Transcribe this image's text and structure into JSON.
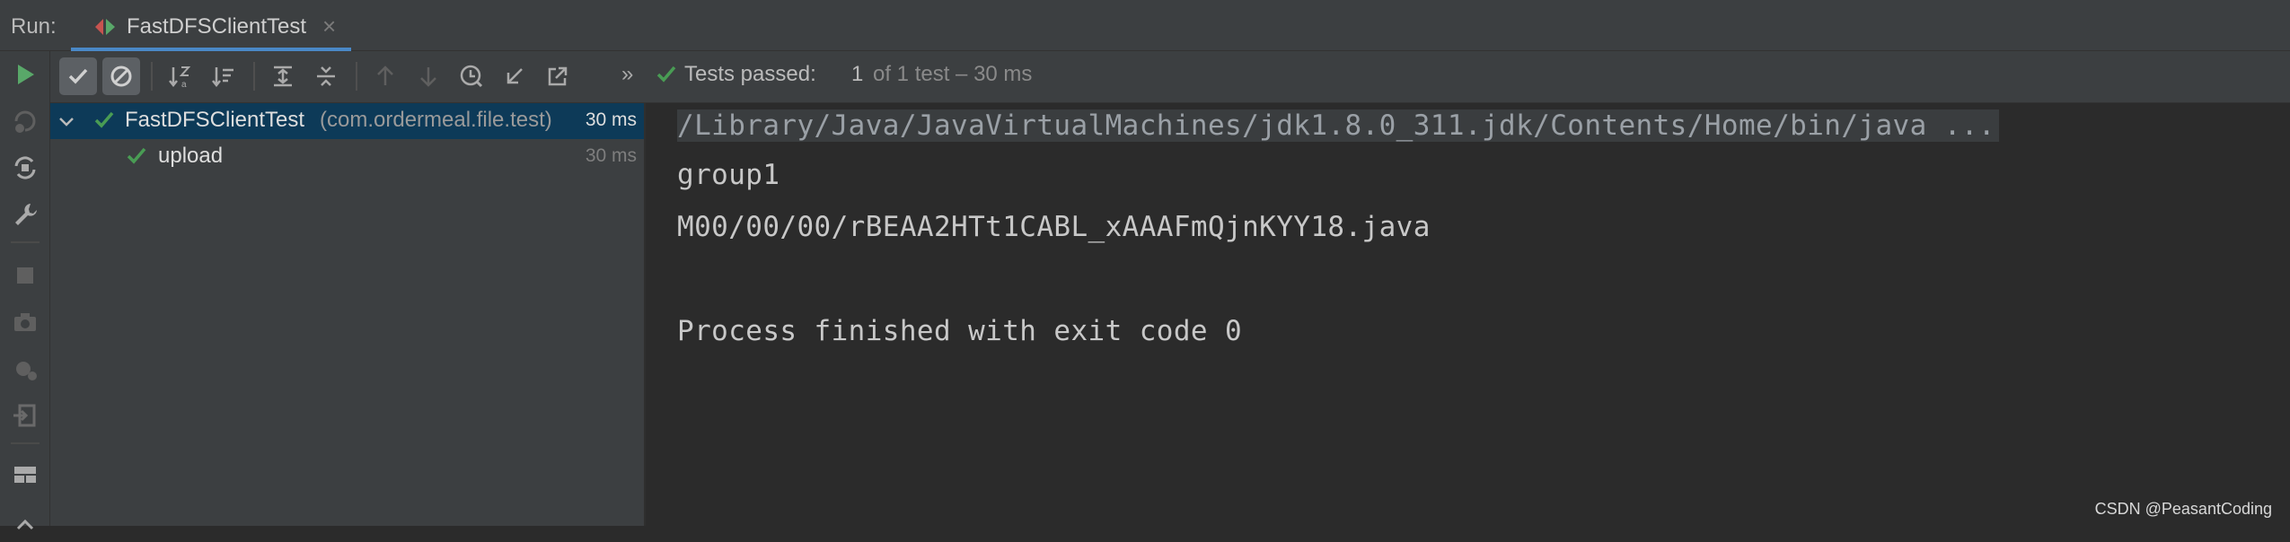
{
  "run_panel": {
    "label": "Run:",
    "tab": {
      "title": "FastDFSClientTest",
      "close": "×"
    }
  },
  "toolbar": {
    "more": "»",
    "status": {
      "label": "Tests passed:",
      "count": "1",
      "total": "of 1 test – 30 ms"
    }
  },
  "tree": {
    "root": {
      "name": "FastDFSClientTest",
      "package": "(com.ordermeal.file.test)",
      "time": "30 ms"
    },
    "children": [
      {
        "name": "upload",
        "time": "30 ms"
      }
    ]
  },
  "console": {
    "lines": [
      "/Library/Java/JavaVirtualMachines/jdk1.8.0_311.jdk/Contents/Home/bin/java ...",
      "group1",
      "M00/00/00/rBEAA2HTt1CABL_xAAAFmQjnKYY18.java",
      "",
      "Process finished with exit code 0"
    ]
  },
  "watermark": "CSDN @PeasantCoding",
  "colors": {
    "pass_green": "#499c54",
    "run_green": "#59a869",
    "selection": "#0d3a58",
    "accent_tab": "#4a88c7"
  }
}
